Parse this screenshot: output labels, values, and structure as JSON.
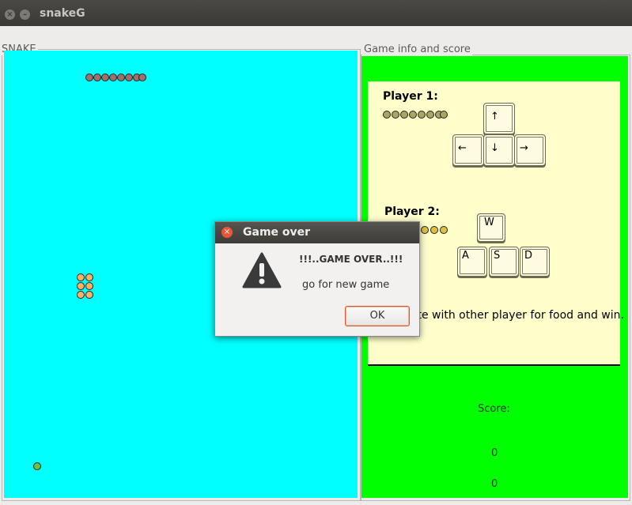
{
  "window": {
    "title": "snakeG",
    "close_icon": "close-icon",
    "minimize_icon": "minimize-icon"
  },
  "snake_panel": {
    "label": "SNAKE"
  },
  "info_panel": {
    "label": "Game info and score",
    "player1": {
      "label": "Player 1:",
      "keys": {
        "up": "↑",
        "left": "←",
        "down": "↓",
        "right": "→"
      }
    },
    "player2": {
      "label": "Player 2:",
      "keys": {
        "up": "W",
        "left": "A",
        "down": "S",
        "right": "D"
      }
    },
    "hint": "Compete with other player for food and win.",
    "score_label": "Score:",
    "scores": [
      "0",
      "0"
    ]
  },
  "dialog": {
    "title": "Game over",
    "heading": "!!!..GAME OVER..!!!",
    "message": "go for new game",
    "ok_label": "OK",
    "icon": "warning-icon"
  },
  "colors": {
    "board": "#00ffff",
    "info_bg": "#00ff00",
    "card": "#ffffcc",
    "accent": "#e8553a"
  }
}
